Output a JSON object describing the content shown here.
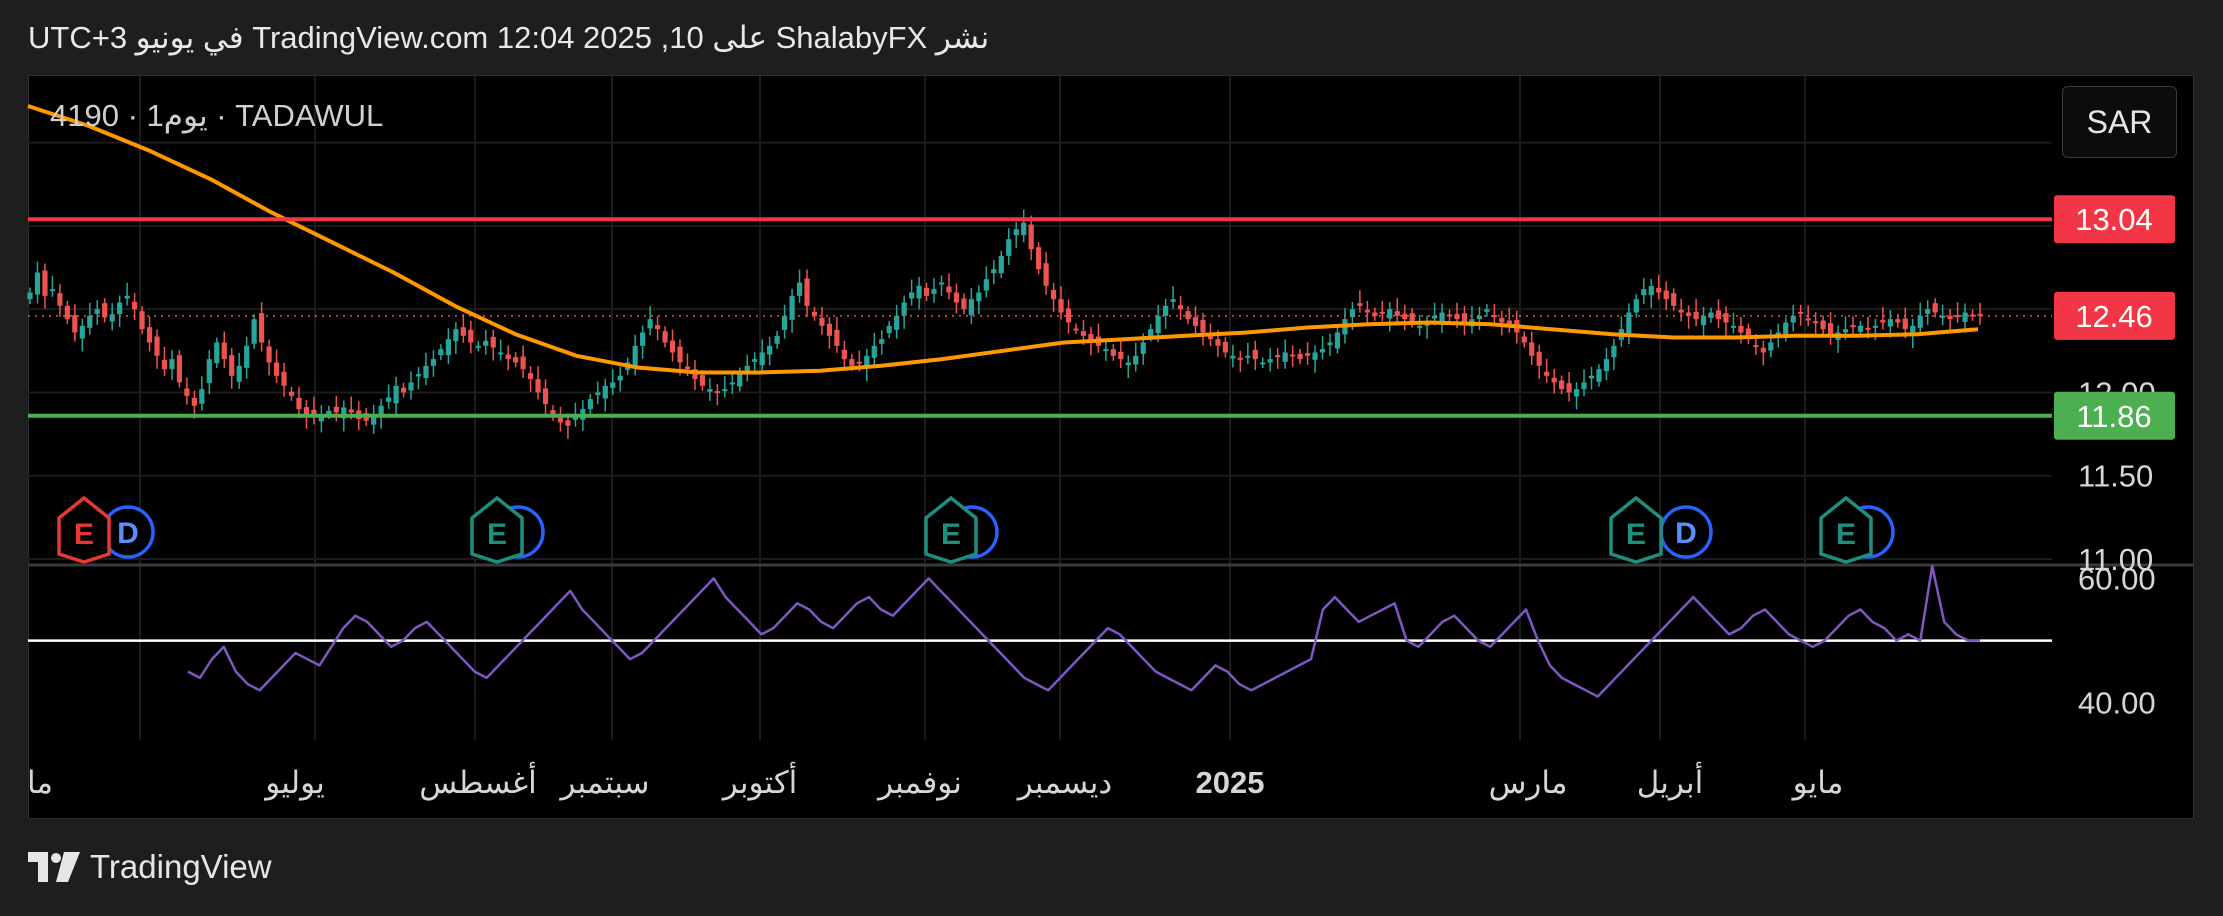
{
  "header": {
    "published_text": "نشر ShalabyFX على TradingView.com 12:04 2025 ,10 في يونيو UTC+3"
  },
  "symbol_label": "4190 · يوم1 · TADAWUL",
  "currency": "SAR",
  "footer": {
    "brand": "TradingView"
  },
  "colors": {
    "background": "#000000",
    "up_candle": "#26a69a",
    "down_candle": "#ef5350",
    "ma_line": "#ff9800",
    "resistance": "#f23645",
    "support": "#4caf50",
    "rsi": "#7e57c2",
    "rsi_midline": "#ffffff"
  },
  "chart_data": [
    {
      "type": "candlestick",
      "ylim": [
        10.97,
        13.9
      ],
      "y_ticks": [
        "13.04",
        "12.46",
        "12.00",
        "11.86",
        "11.50",
        "11.00"
      ],
      "x_ticks": [
        "ما",
        "يوليو",
        "أغسطس",
        "سبتمبر",
        "أكتوبر",
        "نوفمبر",
        "ديسمبر",
        "2025",
        "مارس",
        "أبريل",
        "مايو"
      ],
      "horizontal_lines": [
        {
          "price": 13.04,
          "label": "13.04",
          "color": "#f23645"
        },
        {
          "price": 11.86,
          "label": "11.86",
          "color": "#4caf50"
        }
      ],
      "last_price": {
        "price": 12.46,
        "label": "12.46"
      },
      "moving_average": {
        "x": [
          0,
          10,
          20,
          30,
          40,
          50,
          60,
          70,
          80,
          90,
          100,
          110,
          120,
          130,
          140,
          150,
          160,
          170,
          180,
          190,
          200,
          210,
          220,
          230,
          240,
          250,
          260,
          270,
          280,
          290,
          300,
          310,
          320
        ],
        "y": [
          13.72,
          13.6,
          13.45,
          13.28,
          13.08,
          12.9,
          12.72,
          12.52,
          12.35,
          12.22,
          12.15,
          12.12,
          12.12,
          12.13,
          12.16,
          12.2,
          12.25,
          12.3,
          12.32,
          12.34,
          12.36,
          12.39,
          12.41,
          12.42,
          12.41,
          12.38,
          12.35,
          12.33,
          12.33,
          12.34,
          12.34,
          12.35,
          12.38
        ]
      },
      "closes": [
        12.6,
        12.72,
        12.58,
        12.62,
        12.52,
        12.44,
        12.36,
        12.4,
        12.46,
        12.5,
        12.45,
        12.47,
        12.54,
        12.58,
        12.5,
        12.38,
        12.3,
        12.22,
        12.14,
        12.2,
        12.06,
        11.98,
        11.92,
        12.02,
        12.2,
        12.3,
        12.2,
        12.1,
        12.16,
        12.28,
        12.44,
        12.3,
        12.18,
        12.1,
        12.04,
        11.98,
        11.9,
        11.86,
        11.85,
        11.87,
        11.89,
        11.88,
        11.91,
        11.88,
        11.84,
        11.83,
        11.86,
        11.92,
        11.97,
        12.04,
        12.0,
        12.06,
        12.11,
        12.16,
        12.2,
        12.26,
        12.32,
        12.38,
        12.34,
        12.3,
        12.28,
        12.31,
        12.27,
        12.24,
        12.2,
        12.18,
        12.14,
        12.08,
        12.0,
        11.93,
        11.86,
        11.82,
        11.8,
        11.86,
        11.9,
        11.96,
        12.0,
        12.04,
        12.06,
        12.1,
        12.18,
        12.28,
        12.36,
        12.44,
        12.38,
        12.3,
        12.24,
        12.18,
        12.14,
        12.08,
        12.04,
        12.02,
        12.0,
        12.02,
        12.06,
        12.12,
        12.16,
        12.2,
        12.24,
        12.28,
        12.34,
        12.46,
        12.58,
        12.66,
        12.52,
        12.46,
        12.4,
        12.34,
        12.28,
        12.2,
        12.16,
        12.18,
        12.22,
        12.28,
        12.32,
        12.4,
        12.46,
        12.54,
        12.6,
        12.64,
        12.58,
        12.62,
        12.66,
        12.6,
        12.54,
        12.5,
        12.56,
        12.6,
        12.68,
        12.74,
        12.82,
        12.92,
        12.98,
        13.02,
        12.86,
        12.74,
        12.64,
        12.56,
        12.48,
        12.42,
        12.38,
        12.34,
        12.3,
        12.28,
        12.26,
        12.22,
        12.2,
        12.18,
        12.22,
        12.3,
        12.38,
        12.46,
        12.52,
        12.56,
        12.5,
        12.44,
        12.4,
        12.36,
        12.32,
        12.28,
        12.24,
        12.22,
        12.2,
        12.22,
        12.2,
        12.18,
        12.2,
        12.22,
        12.24,
        12.22,
        12.2,
        12.22,
        12.24,
        12.26,
        12.3,
        12.36,
        12.44,
        12.5,
        12.52,
        12.48,
        12.46,
        12.48,
        12.5,
        12.46,
        12.44,
        12.42,
        12.4,
        12.42,
        12.46,
        12.48,
        12.46,
        12.44,
        12.42,
        12.44,
        12.46,
        12.5,
        12.46,
        12.42,
        12.4,
        12.36,
        12.3,
        12.22,
        12.16,
        12.1,
        12.06,
        12.02,
        12.0,
        12.02,
        12.06,
        12.1,
        12.14,
        12.2,
        12.28,
        12.38,
        12.48,
        12.56,
        12.62,
        12.64,
        12.6,
        12.56,
        12.52,
        12.48,
        12.46,
        12.44,
        12.46,
        12.48,
        12.44,
        12.42,
        12.4,
        12.36,
        12.32,
        12.28,
        12.24,
        12.3,
        12.36,
        12.42,
        12.46,
        12.48,
        12.44,
        12.42,
        12.38,
        12.34,
        12.36,
        12.38,
        12.4,
        12.4,
        12.38,
        12.4,
        12.42,
        12.44,
        12.42,
        12.38,
        12.4,
        12.46,
        12.5,
        12.48,
        12.46,
        12.44,
        12.46,
        12.48,
        12.46,
        12.46
      ]
    },
    {
      "type": "line",
      "series": [
        {
          "values": [
            45,
            44,
            47,
            49,
            45,
            43,
            42,
            44,
            46,
            48,
            47,
            46,
            49,
            52,
            54,
            53,
            51,
            49,
            50,
            52,
            53,
            51,
            49,
            47,
            45,
            44,
            46,
            48,
            50,
            52,
            54,
            56,
            58,
            55,
            53,
            51,
            49,
            47,
            48,
            50,
            52,
            54,
            56,
            58,
            60,
            57,
            55,
            53,
            51,
            52,
            54,
            56,
            55,
            53,
            52,
            54,
            56,
            57,
            55,
            54,
            56,
            58,
            60,
            58,
            56,
            54,
            52,
            50,
            48,
            46,
            44,
            43,
            42,
            44,
            46,
            48,
            50,
            52,
            51,
            49,
            47,
            45,
            44,
            43,
            42,
            44,
            46,
            45,
            43,
            42,
            43,
            44,
            45,
            46,
            47,
            55,
            57,
            55,
            53,
            54,
            55,
            56,
            50,
            49,
            51,
            53,
            54,
            52,
            50,
            49,
            51,
            53,
            55,
            50,
            46,
            44,
            43,
            42,
            41,
            43,
            45,
            47,
            49,
            51,
            53,
            55,
            57,
            55,
            53,
            51,
            52,
            54,
            55,
            53,
            51,
            50,
            49,
            50,
            52,
            54,
            55,
            53,
            52,
            50,
            51,
            50,
            62,
            53,
            51,
            50,
            50
          ]
        }
      ],
      "ylim": [
        34.0,
        62.0
      ],
      "y_ticks": [
        "60.00",
        "40.00"
      ],
      "midline": 50
    }
  ]
}
